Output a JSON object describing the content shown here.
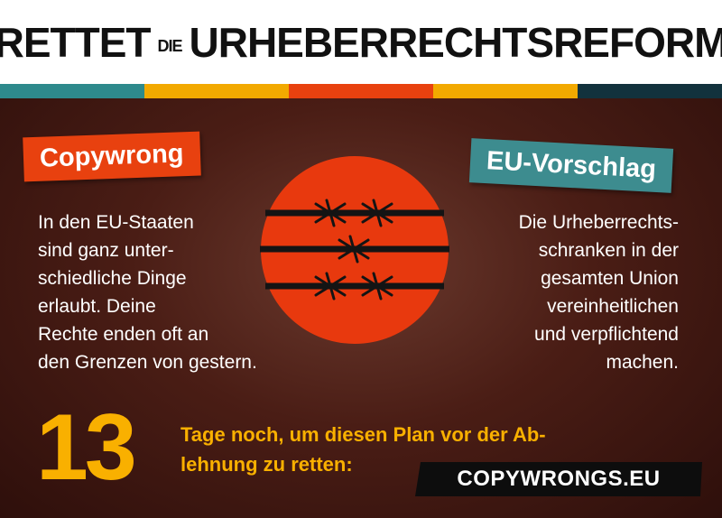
{
  "header": {
    "title_part1": "RETTET",
    "title_small": "DIE",
    "title_part2": "URHEBERRECHTSREFORM"
  },
  "stripe_colors": [
    "#2e8a8c",
    "#f2a900",
    "#e8410f",
    "#f2a900",
    "#12323d"
  ],
  "colors": {
    "copywrong_tag": "#e8410f",
    "proposal_tag": "#3d8c8f",
    "accent_yellow": "#f9b000",
    "background_brown": "#4a1d15"
  },
  "left": {
    "tag": "Copywrong",
    "lines": [
      "In den EU-Staaten",
      "sind ganz unter-",
      "schiedliche Dinge",
      "erlaubt. Deine",
      "Rechte enden oft an",
      "den Grenzen von gestern."
    ]
  },
  "right": {
    "tag": "EU-Vorschlag",
    "lines": [
      "Die Urheberrechts-",
      "schranken in der",
      "gesamten Union",
      "vereinheitlichen",
      "und verpflichtend",
      "machen."
    ]
  },
  "center_icon": "barbed-wire-circle-icon",
  "countdown": {
    "number": "13",
    "text": "Tage noch, um diesen Plan vor der Ab- lehnung zu retten:",
    "text_line1": "Tage noch, um diesen Plan vor der Ab-",
    "text_line2": "lehnung zu retten:"
  },
  "url": "COPYWRONGS.EU"
}
